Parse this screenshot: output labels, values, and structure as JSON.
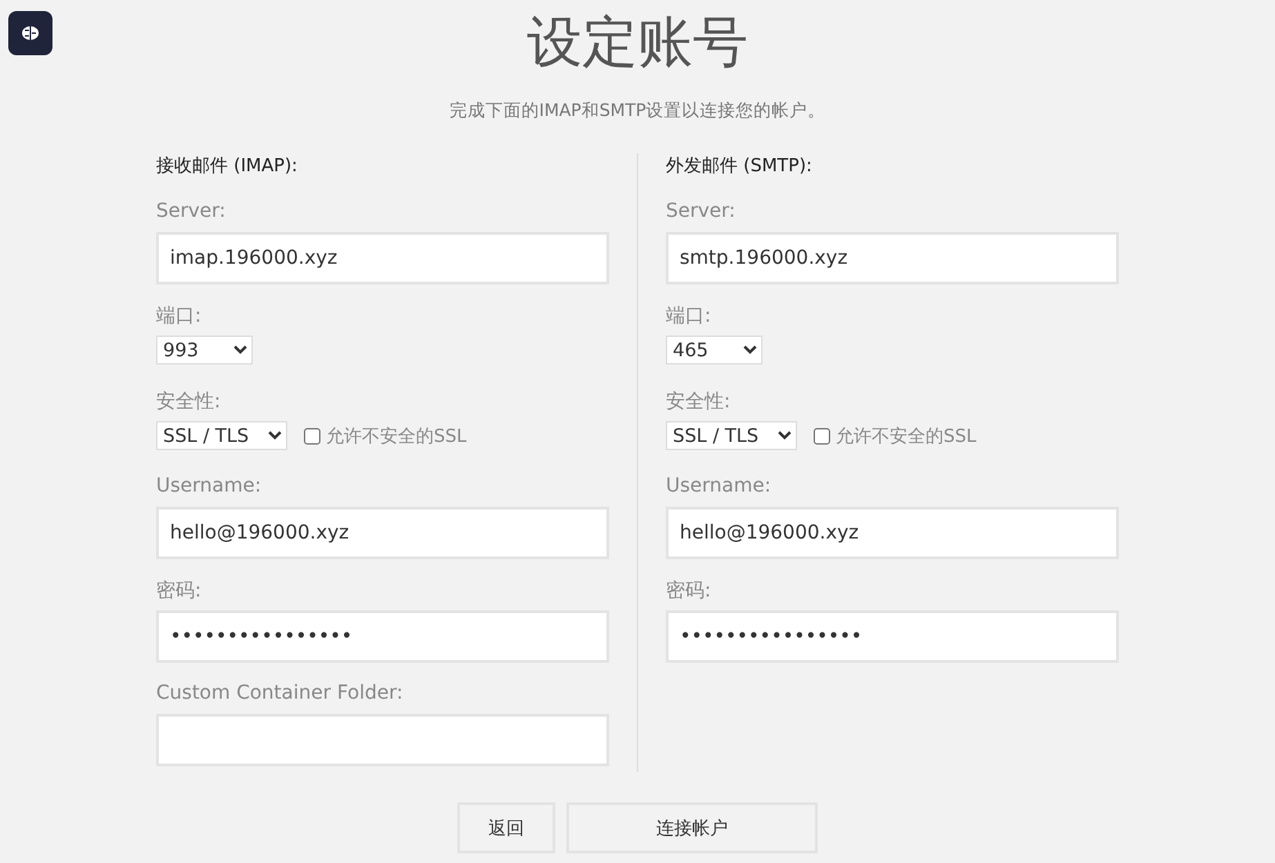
{
  "title": "设定账号",
  "subtitle": "完成下面的IMAP和SMTP设置以连接您的帐户。",
  "columns": [
    {
      "heading": "接收邮件 (IMAP):",
      "fields": [
        {
          "kind": "text",
          "label": "Server:",
          "value": "imap.196000.xyz"
        },
        {
          "kind": "select",
          "label": "端口:",
          "value": "993"
        },
        {
          "kind": "security",
          "label": "安全性:",
          "value": "SSL / TLS",
          "checkbox_label": "允许不安全的SSL",
          "checked": false
        },
        {
          "kind": "text",
          "label": "Username:",
          "value": "hello@196000.xyz"
        },
        {
          "kind": "text",
          "label": "密码:",
          "value": "••••••••••••••••"
        },
        {
          "kind": "text",
          "label": "Custom Container Folder:"
        }
      ]
    },
    {
      "heading": "外发邮件 (SMTP):",
      "fields": [
        {
          "kind": "text",
          "label": "Server:",
          "value": "smtp.196000.xyz"
        },
        {
          "kind": "select",
          "label": "端口:",
          "value": "465"
        },
        {
          "kind": "security",
          "label": "安全性:",
          "value": "SSL / TLS",
          "checkbox_label": "允许不安全的SSL",
          "checked": false
        },
        {
          "kind": "text",
          "label": "Username:",
          "value": "hello@196000.xyz"
        },
        {
          "kind": "text",
          "label": "密码:",
          "value": "••••••••••••••••"
        }
      ]
    }
  ],
  "buttons": [
    {
      "label": "返回",
      "kind": "back"
    },
    {
      "label": "连接帐户",
      "kind": "primary"
    }
  ]
}
